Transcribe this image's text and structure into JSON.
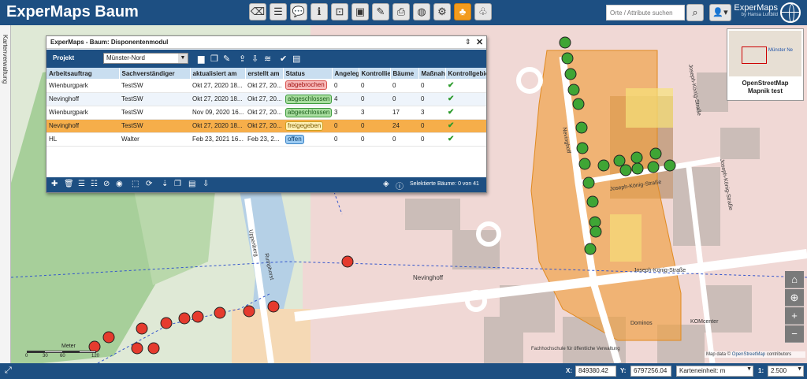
{
  "header": {
    "title": "ExperMaps Baum",
    "search_placeholder": "Orte / Attribute suchen",
    "brand_name": "ExperMaps",
    "brand_sub": "by Hansa Luftbild",
    "toolbar": [
      {
        "name": "eraser-icon",
        "glyph": "⌫"
      },
      {
        "name": "sliders-icon",
        "glyph": "☰"
      },
      {
        "name": "comment-icon",
        "glyph": "💬"
      },
      {
        "name": "info-icon",
        "glyph": "ℹ"
      },
      {
        "name": "zoom-icon",
        "glyph": "⊡"
      },
      {
        "name": "save-icon",
        "glyph": "▣"
      },
      {
        "name": "pen-icon",
        "glyph": "✎"
      },
      {
        "name": "print-icon",
        "glyph": "⎙"
      },
      {
        "name": "globe-icon",
        "glyph": "◍"
      },
      {
        "name": "gear-icon",
        "glyph": "⚙"
      },
      {
        "name": "tree-icon",
        "glyph": "♣",
        "active": true
      },
      {
        "name": "tree-list-icon",
        "glyph": "♧"
      }
    ]
  },
  "sidepanel": {
    "label": "Kartenverwaltung"
  },
  "dialog": {
    "title": "ExperMaps - Baum: Disponentenmodul",
    "project_label": "Projekt",
    "project_value": "Münster-Nord",
    "columns": [
      "Arbeitsauftrag",
      "Sachverständiger",
      "aktualisiert am",
      "erstellt am",
      "Status",
      "Angeleg",
      "Kontrollie",
      "Bäume",
      "Maßnah",
      "Kontrollgebie"
    ],
    "rows": [
      {
        "auftrag": "Wienburgpark",
        "sv": "TestSW",
        "aktualisiert": "Okt 27, 2020 18...",
        "erstellt": "Okt 27, 20...",
        "status": "abgebrochen",
        "angelegt": "0",
        "kontrolliert": "0",
        "baeume": "0",
        "massnahmen": "0",
        "check": "✔"
      },
      {
        "auftrag": "Nevinghoff",
        "sv": "TestSW",
        "aktualisiert": "Okt 27, 2020 18...",
        "erstellt": "Okt 27, 20...",
        "status": "abgeschlossen",
        "angelegt": "4",
        "kontrolliert": "0",
        "baeume": "0",
        "massnahmen": "0",
        "check": "✔"
      },
      {
        "auftrag": "Wienburgpark",
        "sv": "TestSW",
        "aktualisiert": "Nov 09, 2020 16...",
        "erstellt": "Okt 27, 20...",
        "status": "abgeschlossen",
        "angelegt": "3",
        "kontrolliert": "3",
        "baeume": "17",
        "massnahmen": "3",
        "check": "✔"
      },
      {
        "auftrag": "Nevinghoff",
        "sv": "TestSW",
        "aktualisiert": "Okt 27, 2020 18...",
        "erstellt": "Okt 27, 20...",
        "status": "freigegeben",
        "angelegt": "0",
        "kontrolliert": "0",
        "baeume": "24",
        "massnahmen": "0",
        "check": "✔"
      },
      {
        "auftrag": "HL",
        "sv": "Walter",
        "aktualisiert": "Feb 23, 2021 16...",
        "erstellt": "Feb 23, 2...",
        "status": "offen",
        "angelegt": "0",
        "kontrolliert": "0",
        "baeume": "0",
        "massnahmen": "0",
        "check": "✔"
      }
    ],
    "selected_row": 3,
    "status_colors": {
      "abgebrochen": {
        "bg": "#f7b9b9",
        "border": "#d9534f",
        "fg": "#a01010"
      },
      "abgeschlossen": {
        "bg": "#a9dea0",
        "border": "#3c9a3c",
        "fg": "#1d5e1d"
      },
      "freigegeben": {
        "bg": "#fff1b8",
        "border": "#d0a020",
        "fg": "#7a5a00"
      },
      "offen": {
        "bg": "#9ccbf2",
        "border": "#3a82c4",
        "fg": "#0b3f6e"
      }
    },
    "footer_status": "Selektierte Bäume: 0 von 41"
  },
  "map": {
    "labels": {
      "street1": "Nevinghoff",
      "street2": "Joseph-König-Straße",
      "street3": "Joseph-König-Straße",
      "street4": "Joseph-König-Straße",
      "street5": "Joseph-König-Straße",
      "street6": "Nevinghoff",
      "street7": "Uppenberg",
      "street8": "Rumphorst",
      "poi1": "Dominos",
      "poi2": "KOMcenter",
      "poi3": "Fachhochschule für öffentliche Verwaltung"
    },
    "minimap_caption_line1": "OpenStreetMap",
    "minimap_caption_line2": "Mapnik test",
    "minimap_label": "Münster Ne",
    "attribution_prefix": "Map data ©",
    "attribution_link": "OpenStreetMap",
    "attribution_suffix": "contributors",
    "scalebar_title": "Meter",
    "scalebar_ticks": [
      "0",
      "30",
      "60",
      "120"
    ],
    "colors": {
      "tree_green": "#3fa535",
      "tree_red": "#e53b2e",
      "area_orange": "#f0a040"
    }
  },
  "statusbar": {
    "x_label": "X:",
    "x_value": "849380.42",
    "y_label": "Y:",
    "y_value": "6797256.04",
    "unit_value": "Karteneinheit: m",
    "scale_label": "1:",
    "scale_value": "2.500"
  }
}
